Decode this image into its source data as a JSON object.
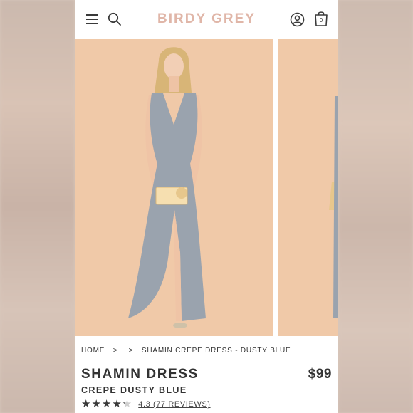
{
  "brand": {
    "logo_text": "BIRDY GREY",
    "logo_color": "#e0b6a8"
  },
  "header": {
    "menu_icon": "hamburger-menu-icon",
    "search_icon": "search-icon",
    "account_icon": "user-account-icon",
    "cart_icon": "shopping-bag-icon",
    "cart_count": "0"
  },
  "gallery": {
    "background_color": "#f0c9a8",
    "dress_color": "#9aa3ae",
    "images": [
      "product-photo-front",
      "product-photo-side"
    ]
  },
  "breadcrumb": {
    "items": [
      "HOME",
      "",
      "SHAMIN CREPE DRESS - DUSTY BLUE"
    ],
    "separator": ">"
  },
  "product": {
    "name": "SHAMIN DRESS",
    "price": "$99",
    "variant": "CREPE DUSTY BLUE",
    "rating_value": 4.3,
    "rating_max": 5,
    "stars_text": "★★★★★",
    "rating_link_text": "4.3 (77 REVIEWS)"
  }
}
